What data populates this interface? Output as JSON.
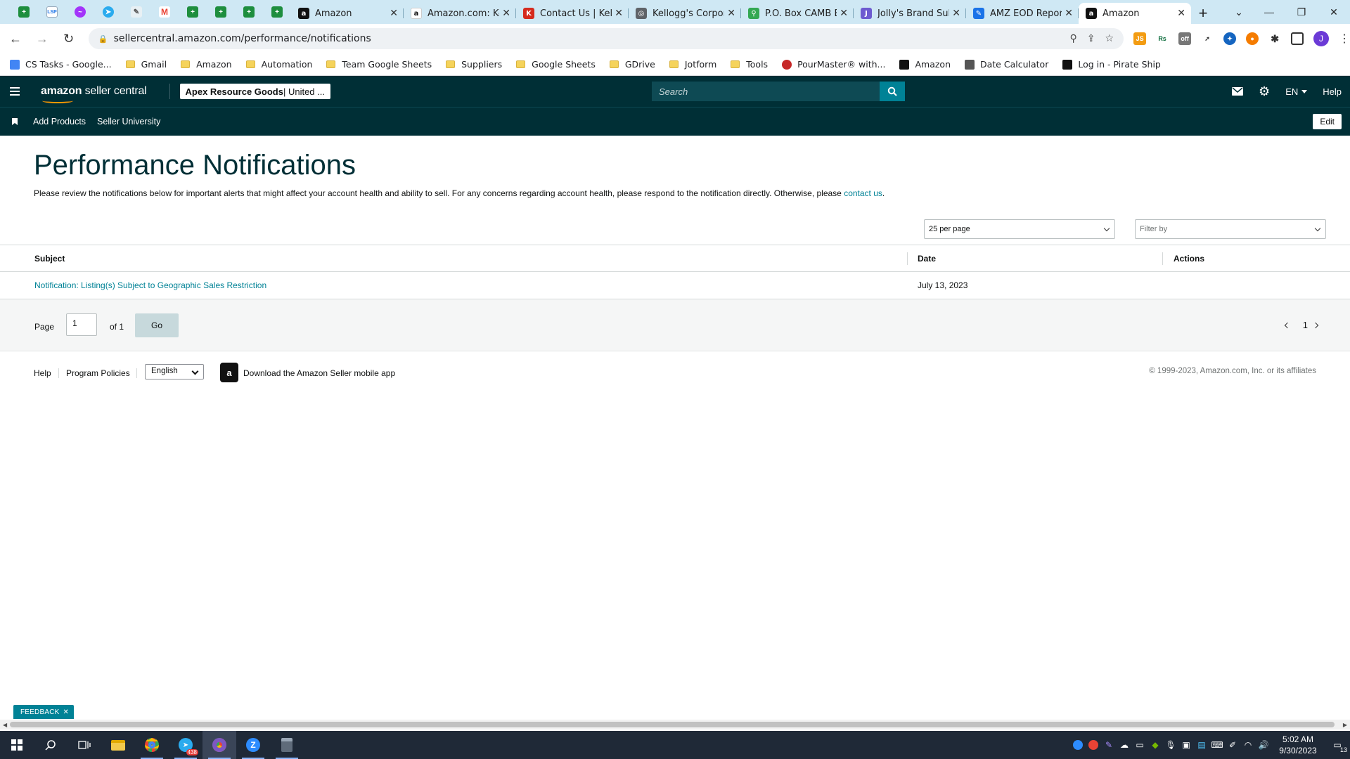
{
  "browser": {
    "tabs": [
      {
        "title": "Amazon",
        "favicon": "amazon-icon",
        "color": "#111111",
        "letter": "a"
      },
      {
        "title": "Amazon.com: Ke",
        "favicon": "amazon-smile-icon",
        "color": "#ffffff",
        "letter": "a"
      },
      {
        "title": "Contact Us | Kell",
        "favicon": "kelloggs-icon",
        "color": "#d52b1e",
        "letter": "K"
      },
      {
        "title": "Kellogg's Corpor",
        "favicon": "globe-icon",
        "color": "#5f6368",
        "letter": "◎"
      },
      {
        "title": "P.O. Box CAMB E",
        "favicon": "maps-pin-icon",
        "color": "#34a853",
        "letter": "⚲"
      },
      {
        "title": "Jolly's Brand Sub",
        "favicon": "brand-icon",
        "color": "#6d5bd0",
        "letter": "J"
      },
      {
        "title": "AMZ EOD Repor",
        "favicon": "report-icon",
        "color": "#1a73e8",
        "letter": "✎"
      },
      {
        "title": "Amazon",
        "favicon": "amazon-icon",
        "color": "#111111",
        "letter": "a",
        "active": true
      }
    ],
    "url": "sellercentral.amazon.com/performance/notifications",
    "bookmarks": [
      {
        "label": "CS Tasks - Google...",
        "type": "doc"
      },
      {
        "label": "Gmail",
        "type": "folder"
      },
      {
        "label": "Amazon",
        "type": "folder"
      },
      {
        "label": "Automation",
        "type": "folder"
      },
      {
        "label": "Team Google Sheets",
        "type": "folder"
      },
      {
        "label": "Suppliers",
        "type": "folder"
      },
      {
        "label": "Google Sheets",
        "type": "folder"
      },
      {
        "label": "GDrive",
        "type": "folder"
      },
      {
        "label": "Jotform",
        "type": "folder"
      },
      {
        "label": "Tools",
        "type": "folder"
      },
      {
        "label": "PourMaster® with...",
        "type": "site"
      },
      {
        "label": "Amazon",
        "type": "amazon"
      },
      {
        "label": "Date Calculator",
        "type": "calc"
      },
      {
        "label": "Log in - Pirate Ship",
        "type": "pirate"
      }
    ],
    "profile_letter": "J"
  },
  "header": {
    "logo_bold": "amazon",
    "logo_thin": " seller central",
    "account_name": "Apex Resource Goods",
    "account_region": " | United ...",
    "search_placeholder": "Search",
    "language": "EN",
    "help": "Help"
  },
  "nav": {
    "links": [
      "Add Products",
      "Seller University"
    ],
    "edit": "Edit"
  },
  "page": {
    "title": "Performance Notifications",
    "description": "Please review the notifications below for important alerts that might affect your account health and ability to sell. For any concerns regarding account health, please respond to the notification directly. Otherwise, please ",
    "contact_link": "contact us",
    "description_end": ".",
    "per_page": "25 per page",
    "filter_placeholder": "Filter by",
    "table": {
      "headers": {
        "subject": "Subject",
        "date": "Date",
        "actions": "Actions"
      },
      "rows": [
        {
          "subject": "Notification: Listing(s) Subject to Geographic Sales Restriction",
          "date": "July 13, 2023",
          "actions": ""
        }
      ]
    },
    "pager": {
      "label": "Page",
      "value": "1",
      "of": "of 1",
      "go": "Go",
      "current": "1"
    }
  },
  "footer": {
    "help": "Help",
    "policies": "Program Policies",
    "language": "English",
    "app": "Download the Amazon Seller mobile app",
    "copyright": "© 1999-2023, Amazon.com, Inc. or its affiliates"
  },
  "feedback": "FEEDBACK",
  "taskbar": {
    "time": "5:02 AM",
    "date": "9/30/2023",
    "notifications": "13",
    "telegram_badge": "438"
  }
}
